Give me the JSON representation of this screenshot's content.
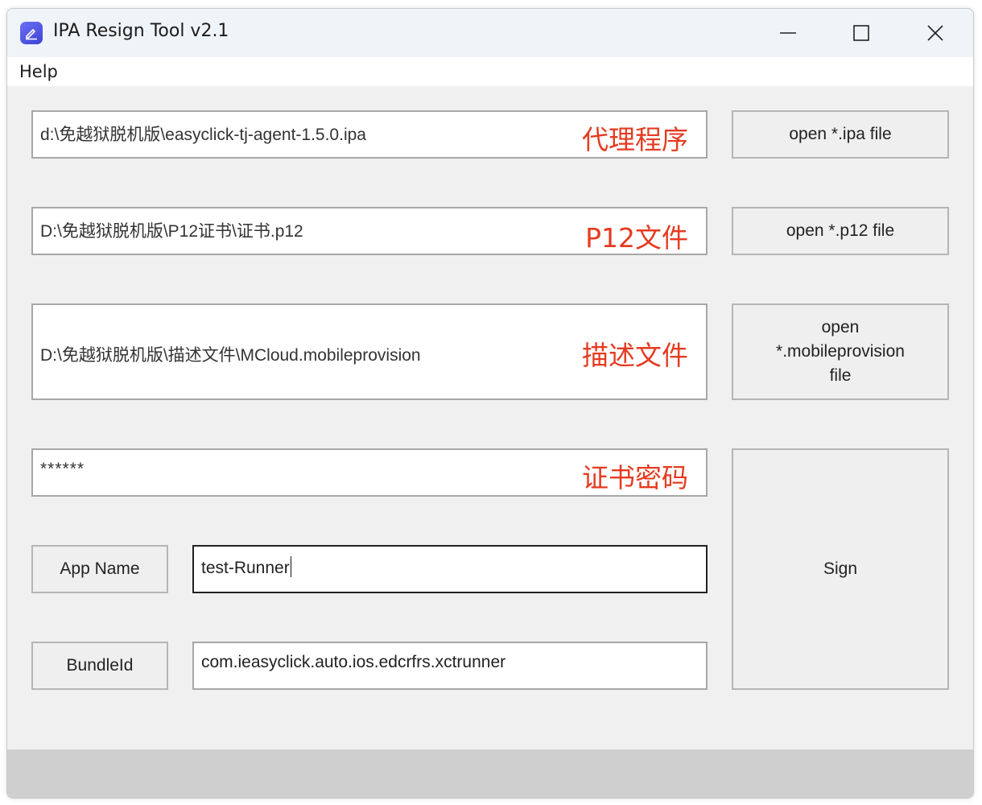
{
  "window": {
    "title": "IPA Resign Tool v2.1",
    "accent_color": "#4f52e6",
    "app_icon": "pencil-edit-icon"
  },
  "controls": {
    "minimize_icon": "minimize-icon",
    "maximize_icon": "maximize-icon",
    "close_icon": "close-icon"
  },
  "menu": {
    "items": [
      "Help"
    ]
  },
  "fields": {
    "ipa_path": {
      "value": "d:\\免越狱脱机版\\easyclick-tj-agent-1.5.0.ipa",
      "hint": "代理程序"
    },
    "p12_path": {
      "value": "D:\\免越狱脱机版\\P12证书\\证书.p12",
      "hint": "P12文件"
    },
    "provision_path": {
      "value": "D:\\免越狱脱机版\\描述文件\\MCloud.mobileprovision",
      "hint": "描述文件"
    },
    "cert_password": {
      "value": "******",
      "hint": "证书密码"
    },
    "app_name": {
      "value": "test-Runner"
    },
    "bundle_id": {
      "value": "com.ieasyclick.auto.ios.edcrfrs.xctrunner"
    }
  },
  "buttons": {
    "open_ipa": "open *.ipa file",
    "open_p12": "open *.p12 file",
    "open_provision_lines": [
      "open",
      "*.mobileprovision",
      "file"
    ],
    "sign": "Sign",
    "app_name": "App Name",
    "bundle_id": "BundleId"
  },
  "colors": {
    "hint_red": "#e53b21",
    "titlebar": "#eff4f8",
    "client_bg": "#f0f0f0",
    "statusbar": "#cfcfcf"
  }
}
